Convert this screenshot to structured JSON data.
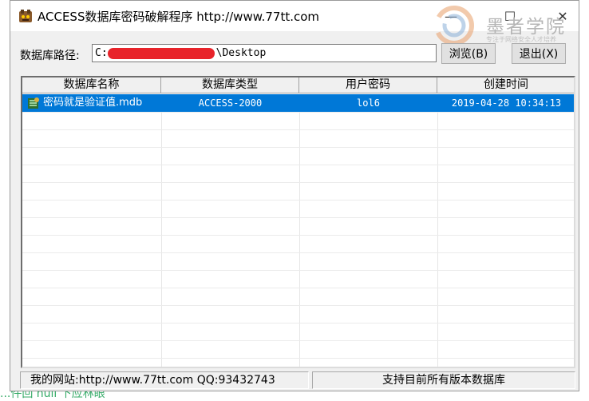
{
  "window": {
    "title": "ACCESS数据库密码破解程序 http://www.77tt.com",
    "min_glyph": "—",
    "max_glyph": "☐",
    "close_glyph": "✕"
  },
  "watermark": {
    "text": "墨者学院",
    "sub": "专注于网络安全人才培养"
  },
  "path": {
    "label": "数据库路径:",
    "prefix": "C:",
    "suffix": "\\Desktop"
  },
  "buttons": {
    "browse": "浏览(B)",
    "exit": "退出(X)"
  },
  "table": {
    "columns": [
      "数据库名称",
      "数据库类型",
      "用户密码",
      "创建时间"
    ],
    "rows": [
      {
        "name": "密码就是验证值.mdb",
        "type": "ACCESS-2000",
        "password": "lol6",
        "created": "2019-04-28 10:34:13",
        "selected": true
      }
    ]
  },
  "status": {
    "left": "我的网站:http://www.77tt.com   QQ:93432743",
    "right": "支持目前所有版本数据库"
  },
  "background": {
    "bottom_text": "...件回    null      下应林眼"
  },
  "colors": {
    "selection": "#0078d7",
    "redaction": "#e8232a"
  }
}
